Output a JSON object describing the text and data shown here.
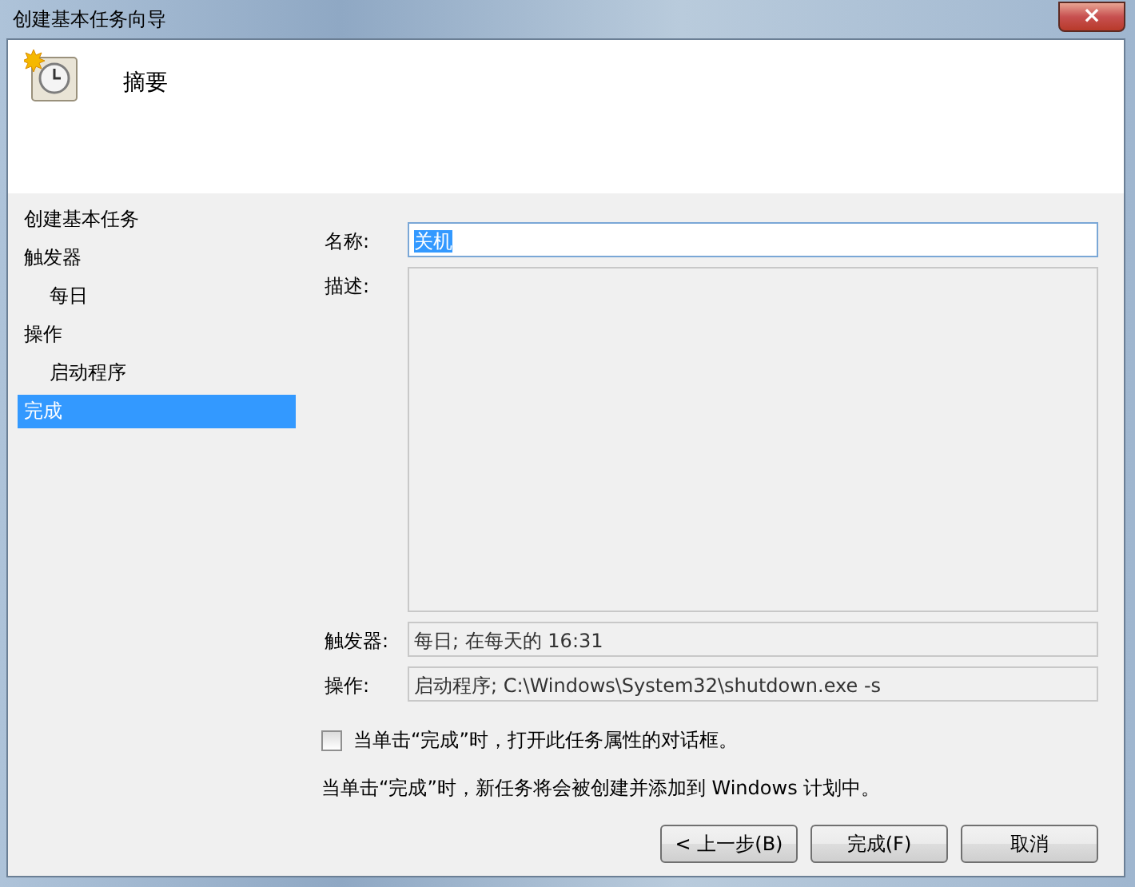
{
  "window": {
    "title": "创建基本任务向导",
    "close": "×"
  },
  "header": {
    "title": "摘要"
  },
  "sidebar": {
    "items": [
      {
        "label": "创建基本任务",
        "selected": false
      },
      {
        "label": "触发器",
        "selected": false,
        "children": [
          {
            "label": "每日",
            "selected": false
          }
        ]
      },
      {
        "label": "操作",
        "selected": false,
        "children": [
          {
            "label": "启动程序",
            "selected": false
          }
        ]
      },
      {
        "label": "完成",
        "selected": true
      }
    ]
  },
  "form": {
    "name_label": "名称:",
    "name_value": "关机",
    "description_label": "描述:",
    "trigger_label": "触发器:",
    "trigger_value": "每日; 在每天的 16:31",
    "action_label": "操作:",
    "action_value": "启动程序; C:\\Windows\\System32\\shutdown.exe -s",
    "open_properties": {
      "label": "当单击“完成”时，打开此任务属性的对话框。",
      "checked": false
    },
    "info": "当单击“完成”时，新任务将会被创建并添加到 Windows 计划中。"
  },
  "buttons": [
    "< 上一步(B)",
    "完成(F)",
    "取消"
  ]
}
